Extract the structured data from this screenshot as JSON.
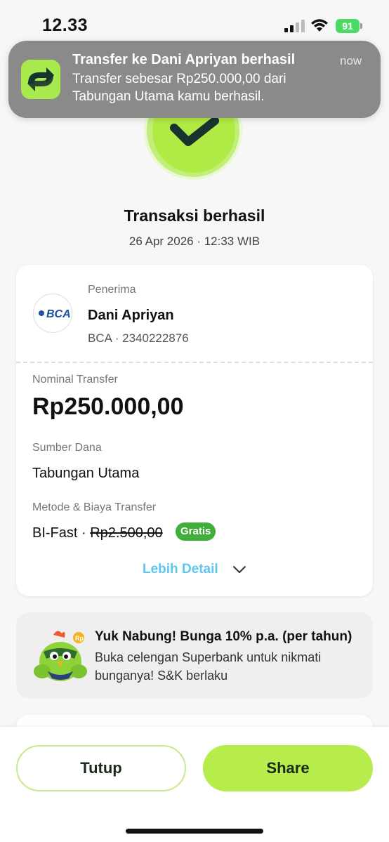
{
  "status_bar": {
    "time": "12.33",
    "battery": "91"
  },
  "notification": {
    "title": "Transfer ke Dani Apriyan berhasil",
    "time": "now",
    "body": "Transfer sebesar Rp250.000,00 dari Tabungan Utama kamu berhasil."
  },
  "transaction": {
    "status": "Transaksi berhasil",
    "datetime": "26 Apr 2026 · 12:33 WIB"
  },
  "recipient": {
    "label": "Penerima",
    "name": "Dani Apriyan",
    "account": "BCA · 2340222876",
    "bank_logo_text": "BCA"
  },
  "details": {
    "nominal_label": "Nominal Transfer",
    "nominal_value": "Rp250.000,00",
    "source_label": "Sumber Dana",
    "source_value": "Tabungan Utama",
    "method_label": "Metode & Biaya Transfer",
    "method_name": "BI-Fast · ",
    "method_fee": "Rp2.500,00",
    "fee_badge": "Gratis",
    "more_detail": "Lebih Detail"
  },
  "promo": {
    "title": "Yuk Nabung! Bunga 10% p.a. (per tahun)",
    "body": "Buka celengan Superbank untuk nikmati bunganya! S&K berlaku",
    "mascot_badge": "Rp"
  },
  "buttons": {
    "close": "Tutup",
    "share": "Share"
  },
  "colors": {
    "accent_green": "#b7ec4d",
    "badge_green": "#3fae3b",
    "link_blue": "#5fc6f0"
  }
}
